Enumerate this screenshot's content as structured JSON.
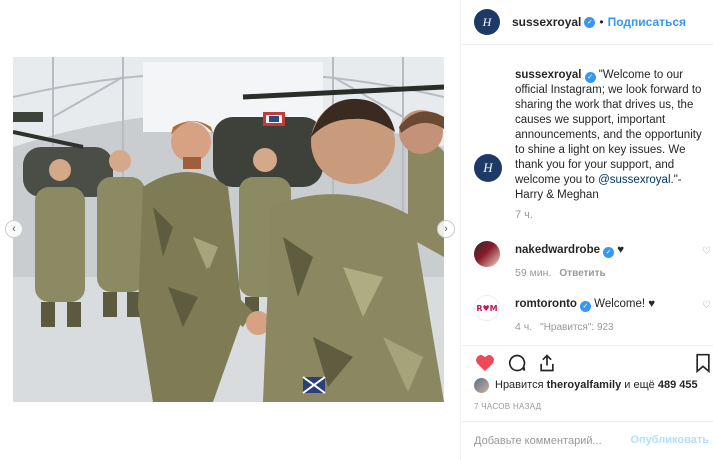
{
  "post": {
    "account": {
      "username": "sussexroyal",
      "verified": true,
      "follow_label": "Подписаться",
      "separator": "•",
      "avatar_monogram": "H"
    },
    "caption": {
      "username": "sussexroyal",
      "text_before_mention": "\"Welcome to our official Instagram; we look forward to sharing the work that drives us, the causes we support, important announcements, and the opportunity to shine a light on key issues. We thank you for your support, and welcome you to ",
      "mention": "@sussexroyal",
      "text_after_mention": ".\"- Harry & Meghan",
      "time": "7 ч."
    },
    "comments": [
      {
        "username": "nakedwardrobe",
        "verified": true,
        "text": "♥",
        "time": "59 мин.",
        "reply_label": "Ответить",
        "likes_label": ""
      },
      {
        "username": "romtoronto",
        "verified": true,
        "text": "Welcome! ♥",
        "time": "4 ч.",
        "reply_label": "",
        "likes_label": "\"Нравится\": 923",
        "avatar_text": "R♥M"
      }
    ],
    "likes": {
      "prefix": "Нравится",
      "user": "theroyalfamily",
      "connector": "и ещё",
      "count": "489 455"
    },
    "posted_ago": "7 ЧАСОВ НАЗАД",
    "comment_input": {
      "placeholder": "Добавьте комментарий...",
      "value": ""
    },
    "publish_label": "Опубликовать"
  },
  "icons": {
    "like": "heart-filled-icon",
    "comment": "comment-bubble-icon",
    "share": "share-arrow-icon",
    "save": "bookmark-icon",
    "prev": "chevron-left-icon",
    "next": "chevron-right-icon"
  },
  "colors": {
    "accent": "#3897f0",
    "like_red": "#ed4956",
    "muted": "#999999",
    "publish_disabled": "#b2dffc"
  }
}
